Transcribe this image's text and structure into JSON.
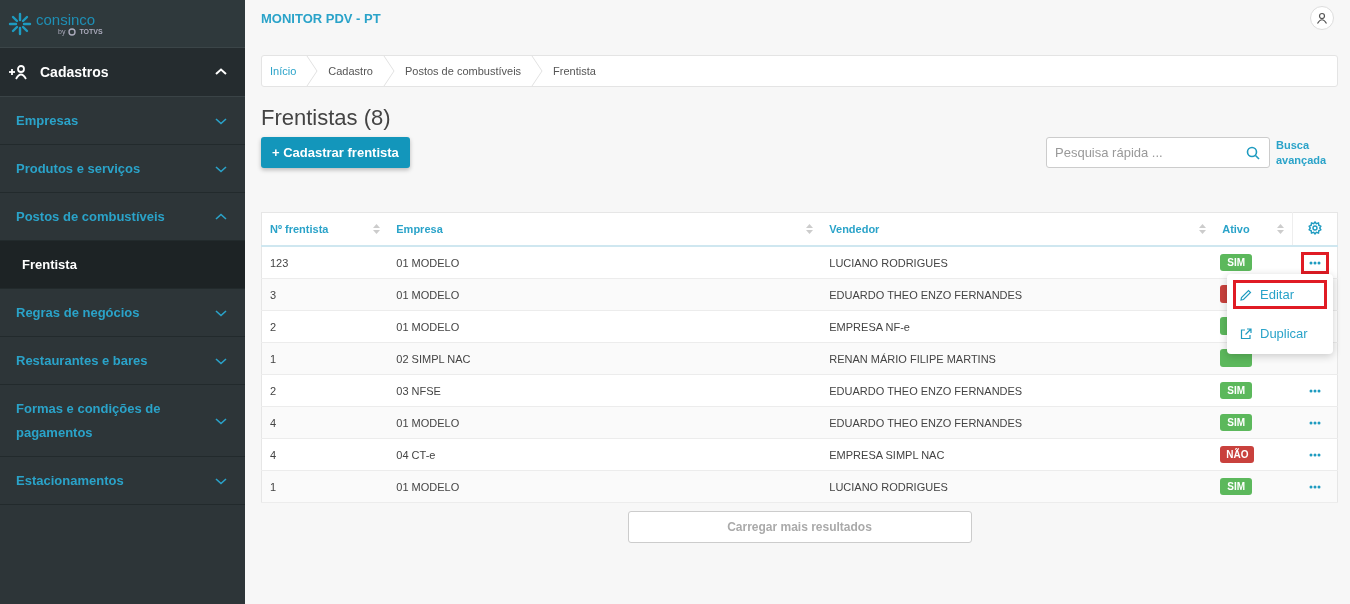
{
  "brand": {
    "name": "consinco",
    "byline": "by",
    "partner": "TOTVS"
  },
  "sidebar": {
    "section": {
      "label": "Cadastros",
      "expanded": true
    },
    "items": [
      {
        "label": "Empresas",
        "expanded": false
      },
      {
        "label": "Produtos e serviços",
        "expanded": false
      },
      {
        "label": "Postos de combustíveis",
        "expanded": true,
        "children": [
          {
            "label": "Frentista",
            "selected": true
          }
        ]
      },
      {
        "label": "Regras de negócios",
        "expanded": false
      },
      {
        "label": "Restaurantes e bares",
        "expanded": false
      },
      {
        "label": "Formas e condições de pagamentos",
        "expanded": false
      },
      {
        "label": "Estacionamentos",
        "expanded": false
      }
    ]
  },
  "header": {
    "title": "MONITOR PDV - PT"
  },
  "breadcrumb": [
    "Início",
    "Cadastro",
    "Postos de combustíveis",
    "Frentista"
  ],
  "page_title": "Frentistas (8)",
  "add_button": "+ Cadastrar frentista",
  "search": {
    "placeholder": "Pesquisa rápida ...",
    "advanced_link": "Busca avançada"
  },
  "table": {
    "columns": [
      "Nº frentista",
      "Empresa",
      "Vendedor",
      "Ativo"
    ],
    "rows": [
      {
        "numero": "123",
        "empresa": "01 MODELO",
        "vendedor": "LUCIANO RODRIGUES",
        "active": true,
        "ativo": "SIM",
        "highlight": true
      },
      {
        "numero": "3",
        "empresa": "01 MODELO",
        "vendedor": "EDUARDO THEO ENZO FERNANDES",
        "active": false,
        "covered": true
      },
      {
        "numero": "2",
        "empresa": "01 MODELO",
        "vendedor": "EMPRESA NF-e",
        "active": true,
        "covered": true
      },
      {
        "numero": "1",
        "empresa": "02 SIMPL NAC",
        "vendedor": "RENAN MÁRIO FILIPE MARTINS",
        "active": true,
        "covered": true
      },
      {
        "numero": "2",
        "empresa": "03 NFSE",
        "vendedor": "EDUARDO THEO ENZO FERNANDES",
        "active": true,
        "ativo": "SIM"
      },
      {
        "numero": "4",
        "empresa": "01 MODELO",
        "vendedor": "EDUARDO THEO ENZO FERNANDES",
        "active": true,
        "ativo": "SIM"
      },
      {
        "numero": "4",
        "empresa": "04 CT-e",
        "vendedor": "EMPRESA SIMPL NAC",
        "active": false,
        "ativo": "NÃO"
      },
      {
        "numero": "1",
        "empresa": "01 MODELO",
        "vendedor": "LUCIANO RODRIGUES",
        "active": true,
        "ativo": "SIM"
      }
    ]
  },
  "row_menu": {
    "items": [
      {
        "label": "Editar",
        "kind": "edit",
        "highlight": true
      },
      {
        "label": "Duplicar",
        "kind": "duplicate",
        "highlight": false
      }
    ]
  },
  "load_more": {
    "label": "Carregar mais resultados",
    "disabled": true
  }
}
